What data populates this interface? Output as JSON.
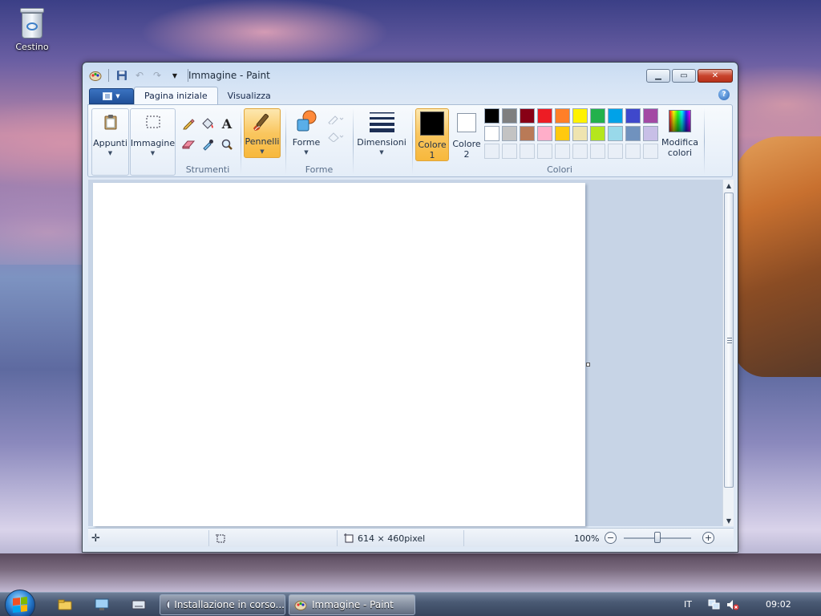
{
  "desktop": {
    "icons": [
      {
        "label": "Cestino",
        "icon": "recycle-bin-icon"
      }
    ]
  },
  "window": {
    "title": "Immagine - Paint",
    "controls": {
      "minimize": "minimize-icon",
      "maximize": "maximize-icon",
      "close": "close-icon"
    }
  },
  "tabs": [
    {
      "label": "Pagina iniziale",
      "active": true
    },
    {
      "label": "Visualizza",
      "active": false
    }
  ],
  "ribbon": {
    "appunti": {
      "label": "Appunti"
    },
    "immagine": {
      "label": "Immagine"
    },
    "strumenti": {
      "group_label": "Strumenti"
    },
    "pennelli": {
      "label": "Pennelli"
    },
    "forme": {
      "label": "Forme",
      "group_label": "Forme"
    },
    "dimensioni": {
      "label": "Dimensioni"
    },
    "colore1": {
      "line1": "Colore",
      "line2": "1",
      "color": "#000000"
    },
    "colore2": {
      "line1": "Colore",
      "line2": "2",
      "color": "#ffffff"
    },
    "colori": {
      "group_label": "Colori"
    },
    "modifica": {
      "line1": "Modifica",
      "line2": "colori"
    }
  },
  "palette": {
    "row1": [
      "#000000",
      "#7f7f7f",
      "#880015",
      "#ed1c24",
      "#ff7f27",
      "#fff200",
      "#22b14c",
      "#00a2e8",
      "#3f48cc",
      "#a349a4"
    ],
    "row2": [
      "#ffffff",
      "#c3c3c3",
      "#b97a57",
      "#ffaec9",
      "#ffc90e",
      "#efe4b0",
      "#b5e61d",
      "#99d9ea",
      "#7092be",
      "#c8bfe7"
    ]
  },
  "statusbar": {
    "image_size": "614 × 460pixel",
    "zoom": "100%"
  },
  "taskbar": {
    "tasks": [
      {
        "label": "Installazione in corso...",
        "icon": "installer-icon"
      },
      {
        "label": "Immagine - Paint",
        "icon": "paint-icon"
      }
    ],
    "language": "IT",
    "clock": "09:02"
  }
}
